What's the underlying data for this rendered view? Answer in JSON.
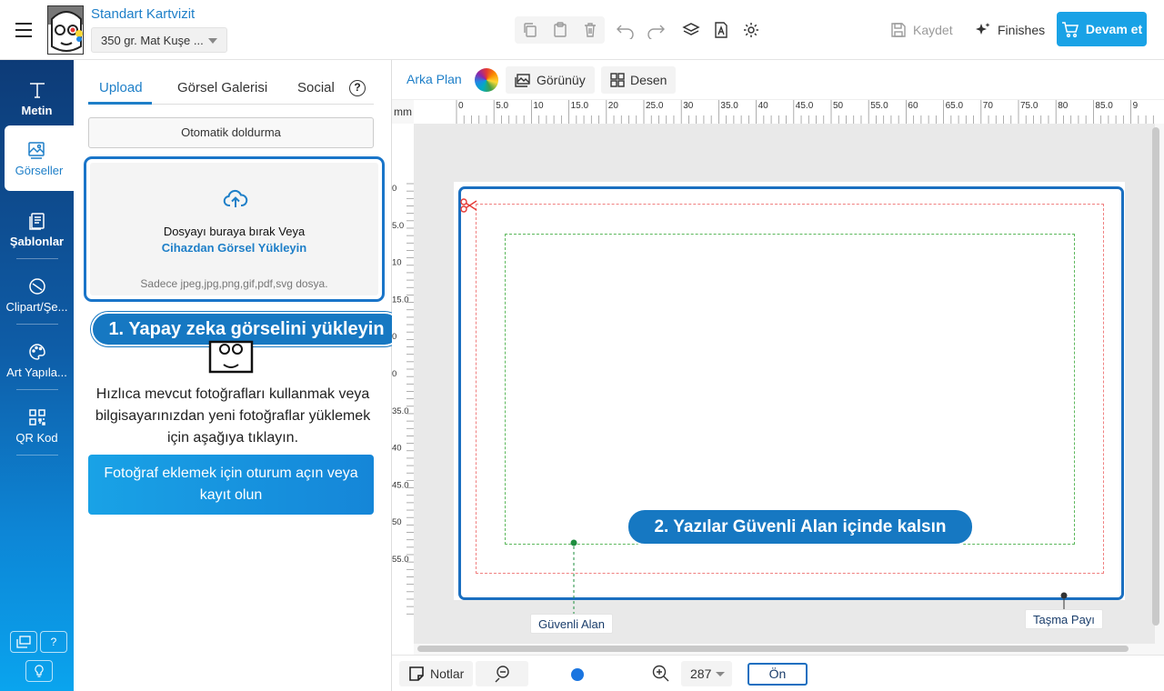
{
  "header": {
    "product_title": "Standart Kartvizit",
    "paper_option": "350 gr. Mat Kuşe ...",
    "save_label": "Kaydet",
    "finishes_label": "Finishes",
    "continue_label": "Devam et",
    "tool_icons": [
      "copy-icon",
      "paste-icon",
      "trash-icon",
      "undo-icon",
      "redo-icon",
      "layers-icon",
      "font-check-icon",
      "settings-icon"
    ]
  },
  "nav": {
    "items": [
      {
        "label": "Metin",
        "icon": "text-icon"
      },
      {
        "label": "Görseller",
        "icon": "image-icon"
      },
      {
        "label": "Şablonlar",
        "icon": "template-icon"
      },
      {
        "label": "Clipart/Şe...",
        "icon": "clipart-icon"
      },
      {
        "label": "Art Yapıla...",
        "icon": "palette-icon"
      },
      {
        "label": "QR Kod",
        "icon": "qr-icon"
      }
    ],
    "help_label": "?"
  },
  "panel": {
    "tabs": [
      "Upload",
      "Görsel Galerisi",
      "Social"
    ],
    "help_label": "?",
    "autofill_label": "Otomatik doldurma",
    "drop_text": "Dosyayı buraya bırak Veya",
    "upload_link": "Cihazdan Görsel Yükleyin",
    "file_types": "Sadece jpeg,jpg,png,gif,pdf,svg dosya.",
    "callout": "1. Yapay zeka görselini yükleyin",
    "info_text": "Hızlıca mevcut fotoğrafları kullanmak veya bilgisayarınızdan yeni fotoğraflar yüklemek için aşağıya tıklayın.",
    "login_button": "Fotoğraf eklemek için oturum açın veya kayıt olun"
  },
  "canvas": {
    "background_label": "Arka Plan",
    "view_label": "Görünüy",
    "pattern_label": "Desen",
    "unit": "mm",
    "ruler_top": [
      "0",
      "5.0",
      "10",
      "15.0",
      "20",
      "25.0",
      "30",
      "35.0",
      "40",
      "45.0",
      "50",
      "55.0",
      "60",
      "65.0",
      "70",
      "75.0",
      "80",
      "85.0",
      "9"
    ],
    "ruler_left": [
      "0",
      "5.0",
      "10",
      "15.0",
      "0",
      "0",
      "35.0",
      "40",
      "45.0",
      "50",
      "55.0"
    ],
    "callout": "2. Yazılar Güvenli Alan içinde kalsın",
    "safe_area_label": "Güvenli Alan",
    "bleed_label": "Taşma Payı",
    "notes_label": "Notlar",
    "zoom_value": "287",
    "side_label": "Ön",
    "colors": {
      "accent": "#1e7fc8",
      "callout": "#1678c2",
      "bleed": "#f08080",
      "safe": "#5cb85c",
      "continue": "#19a2e6"
    }
  }
}
